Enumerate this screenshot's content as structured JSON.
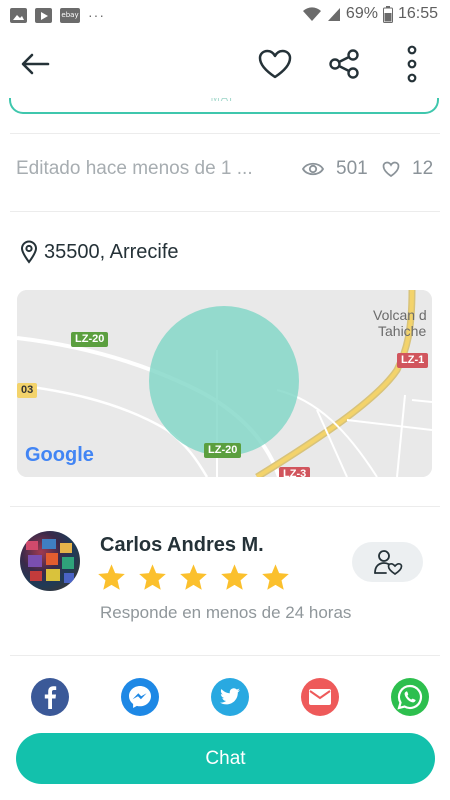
{
  "status_bar": {
    "left_icons": [
      "gallery-icon",
      "youtube-icon",
      "ebay-icon",
      "more-notifications-icon"
    ],
    "ebay_label": "ebay",
    "more": "···",
    "battery": "69%",
    "time": "16:55"
  },
  "app_bar": {
    "icons": [
      "back-arrow-icon",
      "heart-icon",
      "share-icon",
      "more-vertical-icon"
    ]
  },
  "listing": {
    "partial_label": "MAP",
    "edited": "Editado hace menos de 1 ...",
    "views": "501",
    "likes": "12",
    "location": "35500, Arrecife"
  },
  "map": {
    "labels": {
      "lz20_top": "LZ-20",
      "lz20_bottom": "LZ-20",
      "lz1": "LZ-1",
      "lz3": "LZ-3",
      "edge": "03",
      "volcano_line1": "Volcan d",
      "volcano_line2": "Tahiche",
      "google": "Google"
    },
    "colors": {
      "radius": "#7ed6c6",
      "highway": "#f3d36b",
      "road_tag_green": "#5b9f3f",
      "road_tag_red": "#d1555d"
    }
  },
  "seller": {
    "name": "Carlos Andres M.",
    "rating": 5,
    "rating_max": 5,
    "response": "Responde en menos de 24 horas"
  },
  "share_targets": [
    {
      "name": "facebook",
      "color": "#3b5998"
    },
    {
      "name": "messenger",
      "color": "#1e88e5"
    },
    {
      "name": "twitter",
      "color": "#29a9e1"
    },
    {
      "name": "email",
      "color": "#ee5a5a"
    },
    {
      "name": "whatsapp",
      "color": "#2dbf4e"
    }
  ],
  "chat_button": {
    "label": "Chat"
  },
  "colors": {
    "accent": "#13c1ac",
    "star": "#fbc02d"
  }
}
